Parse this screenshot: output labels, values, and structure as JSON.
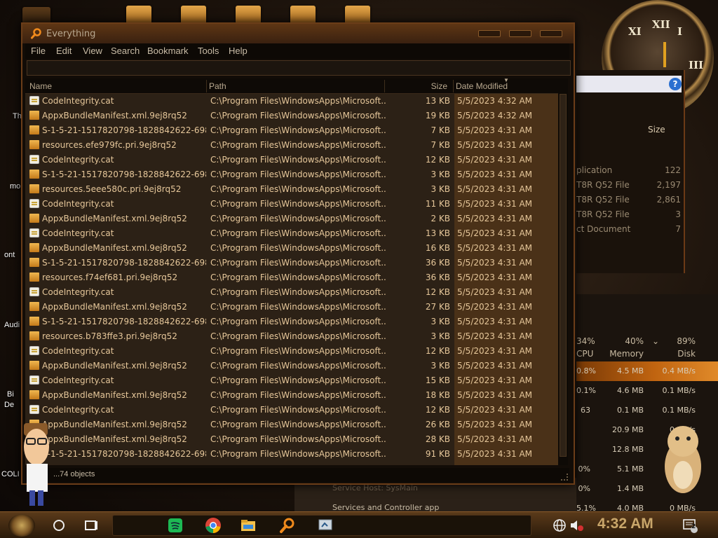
{
  "window": {
    "title": "Everything"
  },
  "menu": [
    "File",
    "Edit",
    "View",
    "Search",
    "Bookmark",
    "Tools",
    "Help"
  ],
  "search": {
    "value": ""
  },
  "columns": {
    "name": "Name",
    "path": "Path",
    "size": "Size",
    "date": "Date Modified"
  },
  "rows": [
    {
      "icon": "cat",
      "name": "CodeIntegrity.cat",
      "path": "C:\\Program Files\\WindowsApps\\Microsoft....",
      "size": "13 KB",
      "date": "5/5/2023 4:32 AM"
    },
    {
      "icon": "folder",
      "name": "AppxBundleManifest.xml.9ej8rq52",
      "path": "C:\\Program Files\\WindowsApps\\Microsoft....",
      "size": "19 KB",
      "date": "5/5/2023 4:32 AM"
    },
    {
      "icon": "folder",
      "name": "S-1-5-21-1517820798-1828842622-698...",
      "path": "C:\\Program Files\\WindowsApps\\Microsoft....",
      "size": "7 KB",
      "date": "5/5/2023 4:31 AM"
    },
    {
      "icon": "folder",
      "name": "resources.efe979fc.pri.9ej8rq52",
      "path": "C:\\Program Files\\WindowsApps\\Microsoft....",
      "size": "7 KB",
      "date": "5/5/2023 4:31 AM"
    },
    {
      "icon": "cat",
      "name": "CodeIntegrity.cat",
      "path": "C:\\Program Files\\WindowsApps\\Microsoft....",
      "size": "12 KB",
      "date": "5/5/2023 4:31 AM"
    },
    {
      "icon": "folder",
      "name": "S-1-5-21-1517820798-1828842622-698...",
      "path": "C:\\Program Files\\WindowsApps\\Microsoft....",
      "size": "3 KB",
      "date": "5/5/2023 4:31 AM"
    },
    {
      "icon": "folder",
      "name": "resources.5eee580c.pri.9ej8rq52",
      "path": "C:\\Program Files\\WindowsApps\\Microsoft....",
      "size": "3 KB",
      "date": "5/5/2023 4:31 AM"
    },
    {
      "icon": "cat",
      "name": "CodeIntegrity.cat",
      "path": "C:\\Program Files\\WindowsApps\\Microsoft....",
      "size": "11 KB",
      "date": "5/5/2023 4:31 AM"
    },
    {
      "icon": "folder",
      "name": "AppxBundleManifest.xml.9ej8rq52",
      "path": "C:\\Program Files\\WindowsApps\\Microsoft....",
      "size": "2 KB",
      "date": "5/5/2023 4:31 AM"
    },
    {
      "icon": "cat",
      "name": "CodeIntegrity.cat",
      "path": "C:\\Program Files\\WindowsApps\\Microsoft....",
      "size": "13 KB",
      "date": "5/5/2023 4:31 AM"
    },
    {
      "icon": "folder",
      "name": "AppxBundleManifest.xml.9ej8rq52",
      "path": "C:\\Program Files\\WindowsApps\\Microsoft....",
      "size": "16 KB",
      "date": "5/5/2023 4:31 AM"
    },
    {
      "icon": "folder",
      "name": "S-1-5-21-1517820798-1828842622-698...",
      "path": "C:\\Program Files\\WindowsApps\\Microsoft....",
      "size": "36 KB",
      "date": "5/5/2023 4:31 AM"
    },
    {
      "icon": "folder",
      "name": "resources.f74ef681.pri.9ej8rq52",
      "path": "C:\\Program Files\\WindowsApps\\Microsoft....",
      "size": "36 KB",
      "date": "5/5/2023 4:31 AM"
    },
    {
      "icon": "cat",
      "name": "CodeIntegrity.cat",
      "path": "C:\\Program Files\\WindowsApps\\Microsoft....",
      "size": "12 KB",
      "date": "5/5/2023 4:31 AM"
    },
    {
      "icon": "folder",
      "name": "AppxBundleManifest.xml.9ej8rq52",
      "path": "C:\\Program Files\\WindowsApps\\Microsoft....",
      "size": "27 KB",
      "date": "5/5/2023 4:31 AM"
    },
    {
      "icon": "folder",
      "name": "S-1-5-21-1517820798-1828842622-698...",
      "path": "C:\\Program Files\\WindowsApps\\Microsoft....",
      "size": "3 KB",
      "date": "5/5/2023 4:31 AM"
    },
    {
      "icon": "folder",
      "name": "resources.b783ffe3.pri.9ej8rq52",
      "path": "C:\\Program Files\\WindowsApps\\Microsoft....",
      "size": "3 KB",
      "date": "5/5/2023 4:31 AM"
    },
    {
      "icon": "cat",
      "name": "CodeIntegrity.cat",
      "path": "C:\\Program Files\\WindowsApps\\Microsoft....",
      "size": "12 KB",
      "date": "5/5/2023 4:31 AM"
    },
    {
      "icon": "folder",
      "name": "AppxBundleManifest.xml.9ej8rq52",
      "path": "C:\\Program Files\\WindowsApps\\Microsoft....",
      "size": "3 KB",
      "date": "5/5/2023 4:31 AM"
    },
    {
      "icon": "cat",
      "name": "CodeIntegrity.cat",
      "path": "C:\\Program Files\\WindowsApps\\Microsoft....",
      "size": "15 KB",
      "date": "5/5/2023 4:31 AM"
    },
    {
      "icon": "folder",
      "name": "AppxBundleManifest.xml.9ej8rq52",
      "path": "C:\\Program Files\\WindowsApps\\Microsoft....",
      "size": "18 KB",
      "date": "5/5/2023 4:31 AM"
    },
    {
      "icon": "cat",
      "name": "CodeIntegrity.cat",
      "path": "C:\\Program Files\\WindowsApps\\Microsoft....",
      "size": "12 KB",
      "date": "5/5/2023 4:31 AM"
    },
    {
      "icon": "folder",
      "name": "AppxBundleManifest.xml.9ej8rq52",
      "path": "C:\\Program Files\\WindowsApps\\Microsoft....",
      "size": "26 KB",
      "date": "5/5/2023 4:31 AM"
    },
    {
      "icon": "folder",
      "name": "AppxBundleManifest.xml.9ej8rq52",
      "path": "C:\\Program Files\\WindowsApps\\Microsoft....",
      "size": "28 KB",
      "date": "5/5/2023 4:31 AM"
    },
    {
      "icon": "folder",
      "name": "S-1-5-21-1517820798-1828842622-698...",
      "path": "C:\\Program Files\\WindowsApps\\Microsoft....",
      "size": "91 KB",
      "date": "5/5/2023 4:31 AM"
    }
  ],
  "status": {
    "objects": "...74 objects"
  },
  "side_panel": {
    "size_header": "Size",
    "rows": [
      {
        "type": "plication",
        "size": "122"
      },
      {
        "type": "T8R Q52 File",
        "size": "2,197"
      },
      {
        "type": "T8R Q52 File",
        "size": "2,861"
      },
      {
        "type": "T8R Q52 File",
        "size": "3"
      },
      {
        "type": "ct Document",
        "size": "7"
      }
    ]
  },
  "task_manager": {
    "cpu_pct": "34%",
    "cpu_label": "CPU",
    "mem_pct": "40%",
    "mem_label": "Memory",
    "disk_pct": "89%",
    "disk_label": "Disk",
    "rows": [
      {
        "cpu": "0.8%",
        "mem": "4.5 MB",
        "disk": "0.4 MB/s"
      },
      {
        "cpu": "0.1%",
        "mem": "4.6 MB",
        "disk": "0.1 MB/s"
      },
      {
        "cpu": "63",
        "mem": "0.1 MB",
        "disk": "0.1 MB/s"
      },
      {
        "cpu": "",
        "mem": "20.9 MB",
        "disk": "0 MB/s"
      },
      {
        "cpu": "",
        "mem": "12.8 MB",
        "disk": ""
      },
      {
        "cpu": "0%",
        "mem": "5.1 MB",
        "disk": ""
      },
      {
        "cpu": "0%",
        "mem": "1.4 MB",
        "disk": ""
      },
      {
        "cpu": "5.1%",
        "mem": "4.0 MB",
        "disk": "0 MB/s"
      }
    ],
    "process_1": "Service Host: SysMain",
    "process_2": "Services and Controller app"
  },
  "desktop_labels": [
    "Th",
    "mo",
    "ont",
    "Audi",
    "Bi",
    "De",
    "COLI"
  ],
  "taskbar": {
    "time": "4:32 AM",
    "notification_count": "2",
    "pinned": [
      "spotify-icon",
      "chrome-icon",
      "file-explorer-icon",
      "search-everything-icon",
      "app-icon"
    ]
  },
  "colors": {
    "accent": "#e08a2a",
    "window_border": "#6b3d18",
    "row_text": "#e6c79a",
    "date_column_bg": "#4a3118"
  }
}
